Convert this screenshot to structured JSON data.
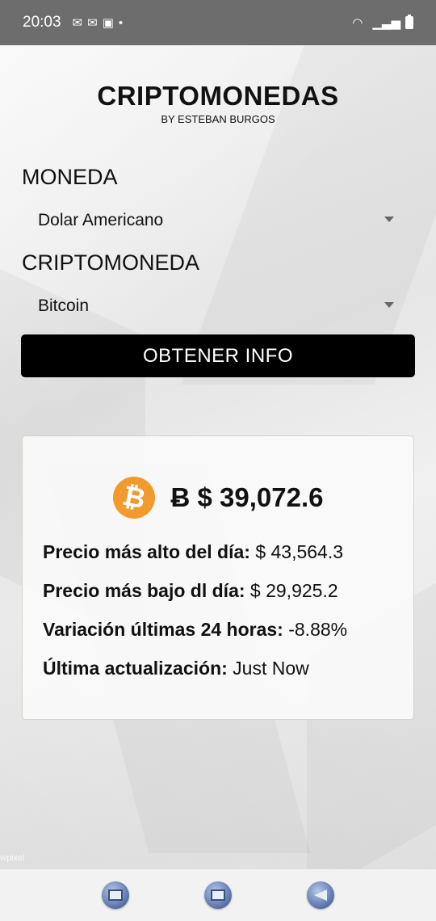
{
  "status": {
    "time": "20:03",
    "icons": [
      "gmail-icon",
      "gmail-icon",
      "image-icon",
      "dot-icon"
    ],
    "right_icons": [
      "wifi-icon",
      "signal-icon",
      "battery-icon"
    ]
  },
  "header": {
    "title": "CRIPTOMONEDAS",
    "subtitle": "BY ESTEBAN BURGOS"
  },
  "form": {
    "currency_label": "MONEDA",
    "currency_value": "Dolar Americano",
    "crypto_label": "CRIPTOMONEDA",
    "crypto_value": "Bitcoin",
    "button_label": "OBTENER INFO"
  },
  "result": {
    "coin_symbol": "₿",
    "price": "Ƀ $ 39,072.6",
    "high_label": "Precio más alto del día:",
    "high_value": "$ 43,564.3",
    "low_label": "Precio más bajo dl día:",
    "low_value": "$ 29,925.2",
    "change_label": "Variación últimas 24 horas:",
    "change_value": "-8.88%",
    "updated_label": "Última actualización:",
    "updated_value": "Just Now"
  },
  "watermark": "wpixel",
  "colors": {
    "accent": "#000000",
    "bitcoin": "#f39a2e",
    "status_bar": "#6d6d6d"
  }
}
